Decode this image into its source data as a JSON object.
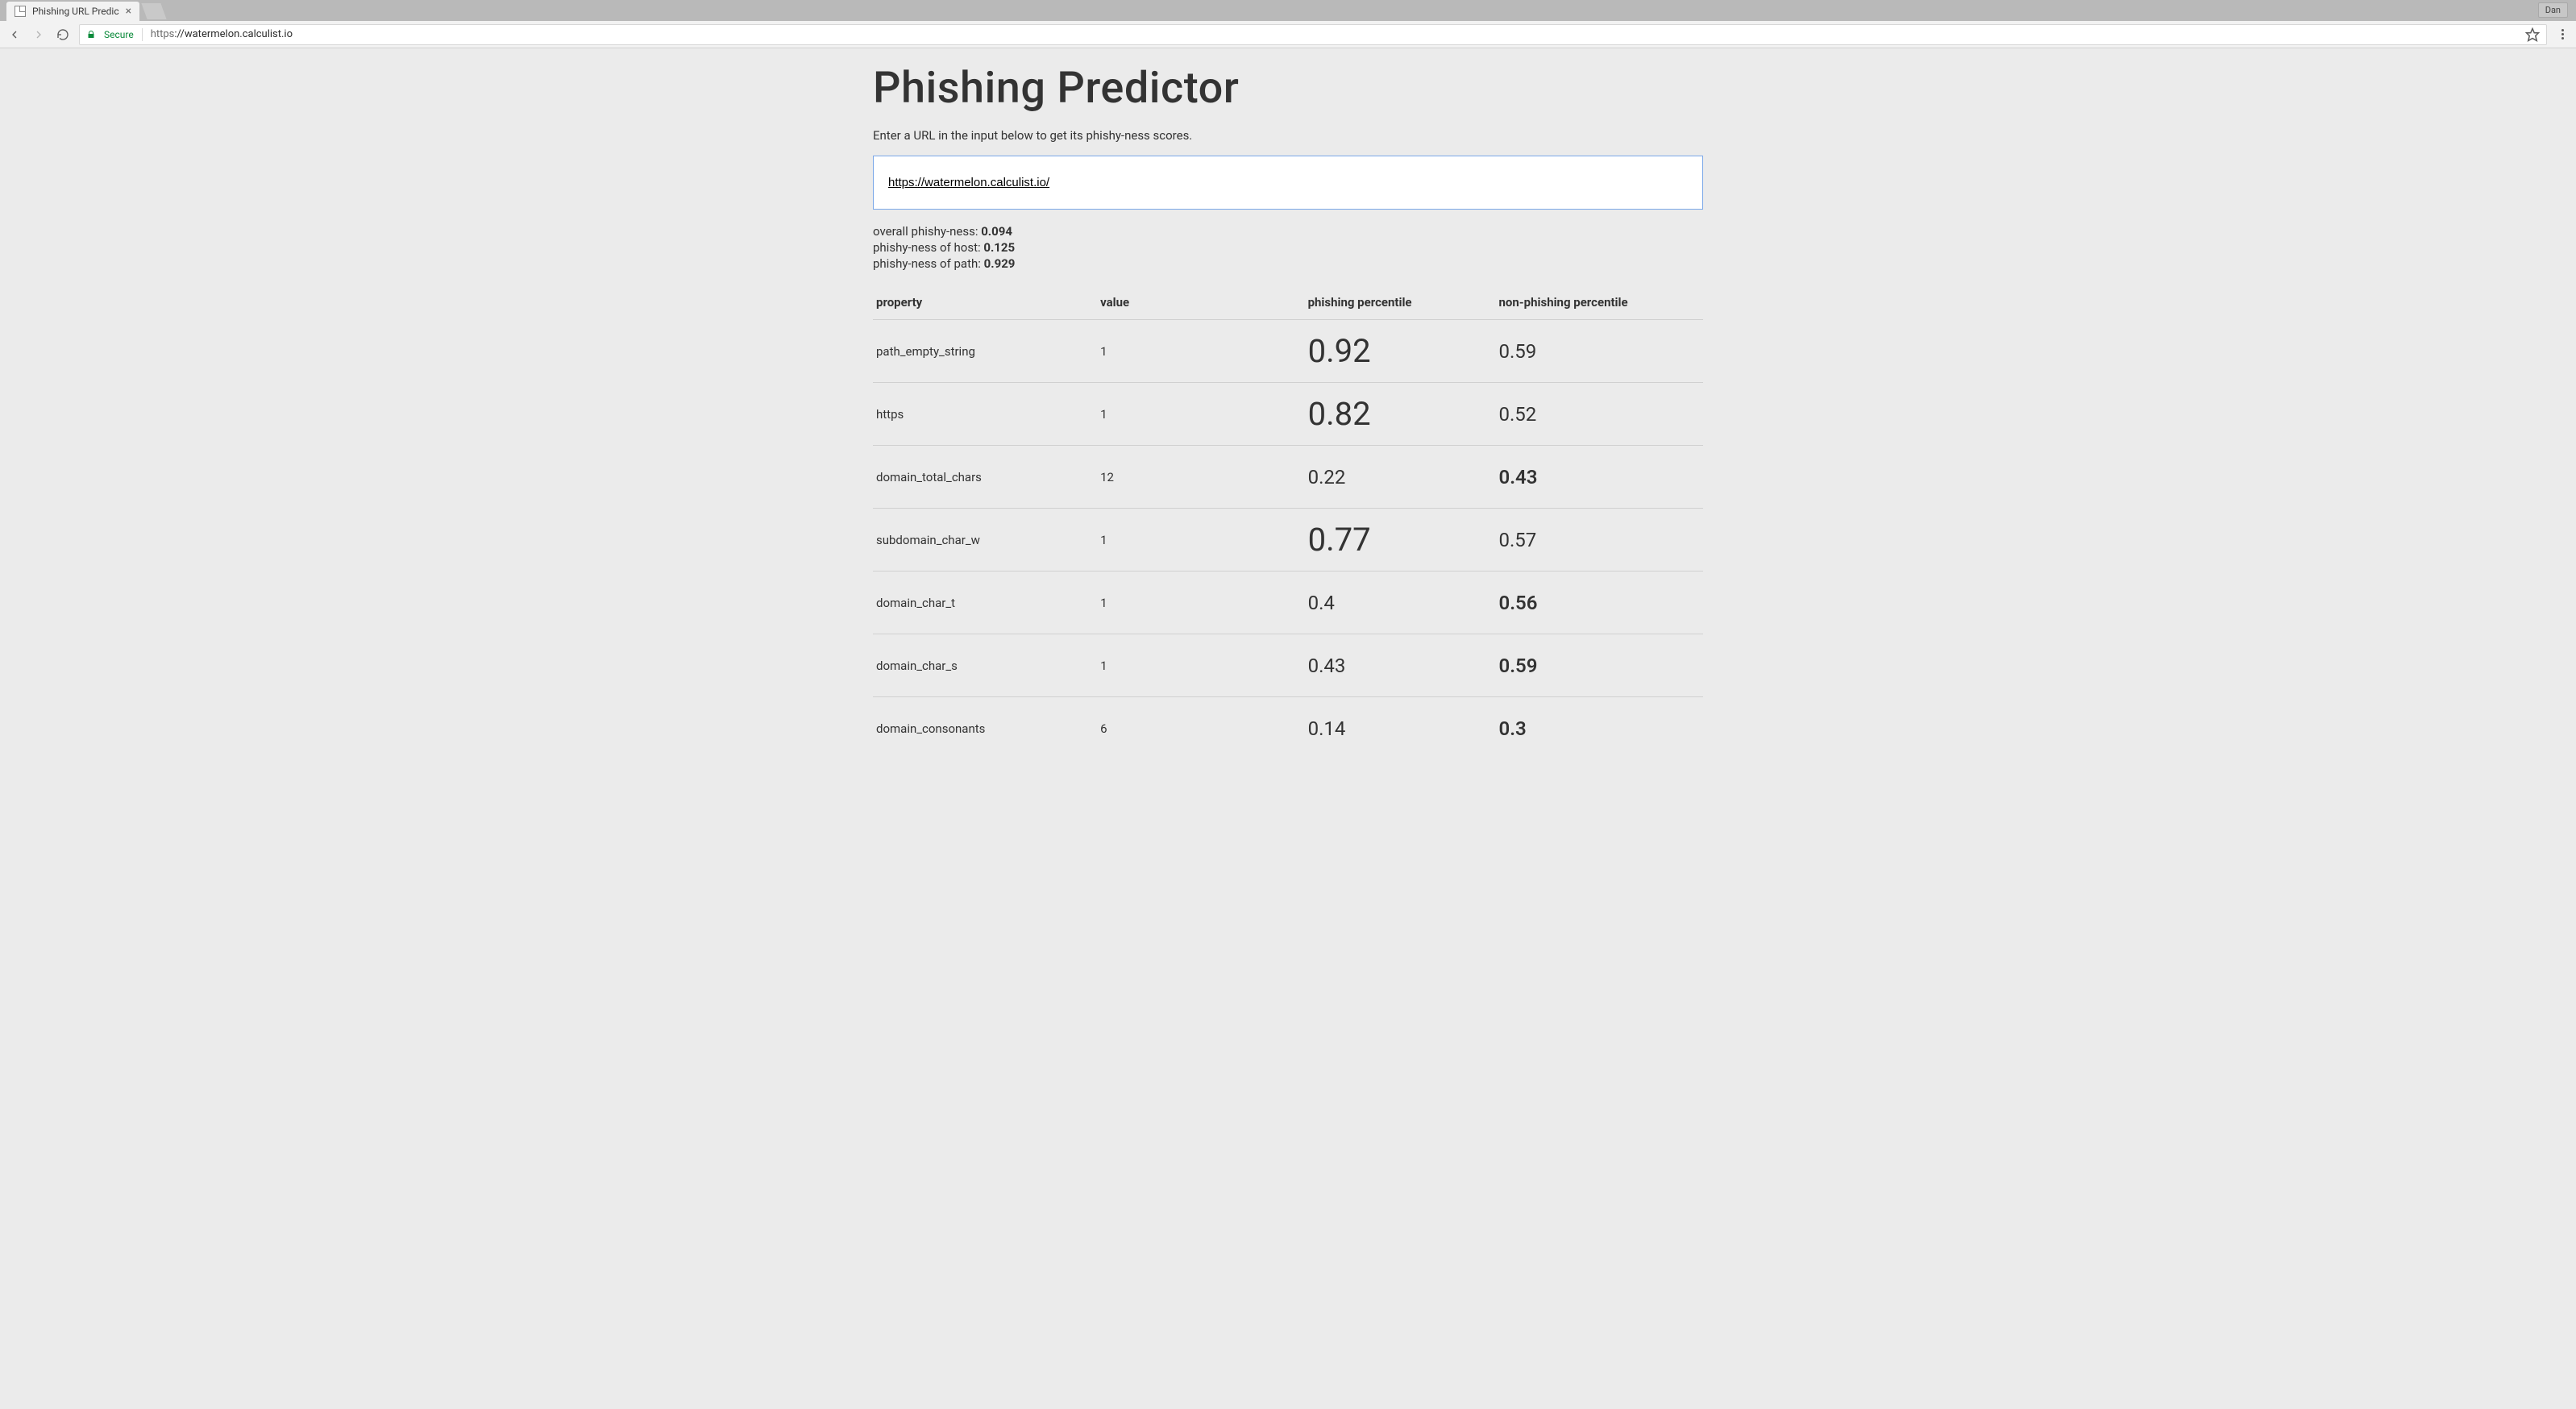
{
  "browser": {
    "tab_title": "Phishing URL Predic",
    "profile_name": "Dan",
    "secure_label": "Secure",
    "url_proto": "https",
    "url_host": "://watermelon.calculist.io",
    "url_path": ""
  },
  "page": {
    "title": "Phishing Predictor",
    "instructions": "Enter a URL in the input below to get its phishy-ness scores.",
    "input_value": "https://watermelon.calculist.io/",
    "scores": {
      "overall_label": "overall phishy-ness: ",
      "overall_value": "0.094",
      "host_label": "phishy-ness of host: ",
      "host_value": "0.125",
      "path_label": "phishy-ness of path: ",
      "path_value": "0.929"
    },
    "headers": {
      "property": "property",
      "value": "value",
      "phishing_percentile": "phishing percentile",
      "non_phishing_percentile": "non-phishing percentile"
    },
    "rows": [
      {
        "property": "path_empty_string",
        "value": "1",
        "pp": "0.92",
        "np": "0.59",
        "pp_emph": "big",
        "np_emph": ""
      },
      {
        "property": "https",
        "value": "1",
        "pp": "0.82",
        "np": "0.52",
        "pp_emph": "big",
        "np_emph": ""
      },
      {
        "property": "domain_total_chars",
        "value": "12",
        "pp": "0.22",
        "np": "0.43",
        "pp_emph": "",
        "np_emph": "bold"
      },
      {
        "property": "subdomain_char_w",
        "value": "1",
        "pp": "0.77",
        "np": "0.57",
        "pp_emph": "big",
        "np_emph": ""
      },
      {
        "property": "domain_char_t",
        "value": "1",
        "pp": "0.4",
        "np": "0.56",
        "pp_emph": "",
        "np_emph": "bold"
      },
      {
        "property": "domain_char_s",
        "value": "1",
        "pp": "0.43",
        "np": "0.59",
        "pp_emph": "",
        "np_emph": "bold"
      },
      {
        "property": "domain_consonants",
        "value": "6",
        "pp": "0.14",
        "np": "0.3",
        "pp_emph": "",
        "np_emph": "bold"
      }
    ]
  }
}
